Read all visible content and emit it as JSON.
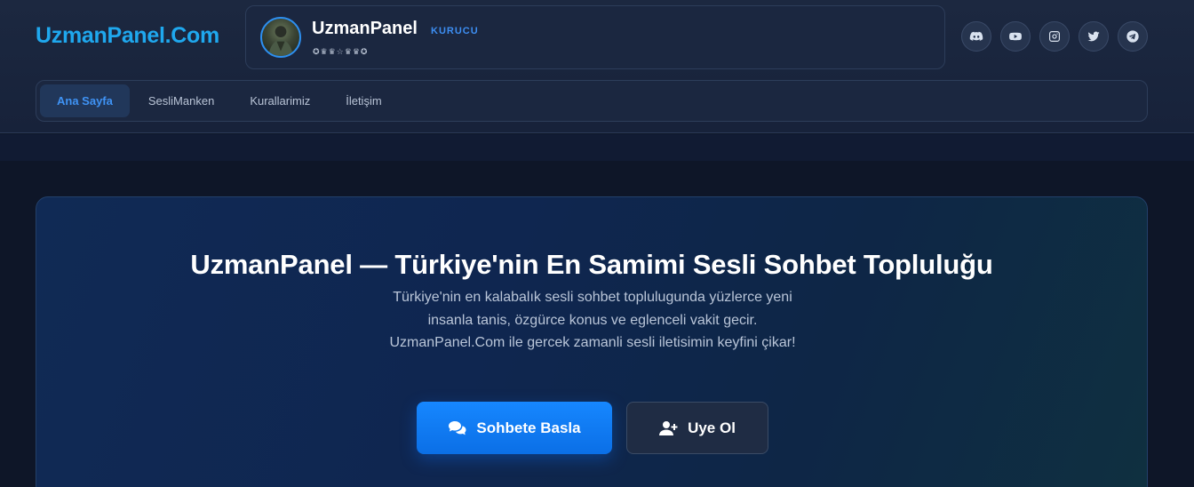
{
  "brand": {
    "name": "UzmanPanel.Com",
    "color": "#1fa8ee"
  },
  "profile": {
    "name": "UzmanPanel",
    "role": "KURUCU",
    "badges": "✪♛♛☆♛♛✪"
  },
  "socials": [
    {
      "icon": "discord-icon"
    },
    {
      "icon": "youtube-icon"
    },
    {
      "icon": "instagram-icon"
    },
    {
      "icon": "twitter-icon"
    },
    {
      "icon": "telegram-icon"
    }
  ],
  "nav": {
    "items": [
      {
        "label": "Ana Sayfa",
        "active": true
      },
      {
        "label": "SesliManken"
      },
      {
        "label": "Kurallarimiz"
      },
      {
        "label": "İletişim"
      }
    ]
  },
  "hero": {
    "title": "UzmanPanel — Türkiye'nin En Samimi Sesli Sohbet Topluluğu",
    "description": "Türkiye'nin en kalabalık sesli sohbet toplulugunda yüzlerce yeni insanla tanis, özgürce konus ve eglenceli vakit gecir. UzmanPanel.Com ile gercek zamanli sesli iletisimin keyfini çikar!",
    "primary_button": "Sohbete Basla",
    "secondary_button": "Uye Ol"
  },
  "colors": {
    "accent": "#1687ff",
    "nav_active": "#3f93f5",
    "role": "#3d8ef2"
  }
}
